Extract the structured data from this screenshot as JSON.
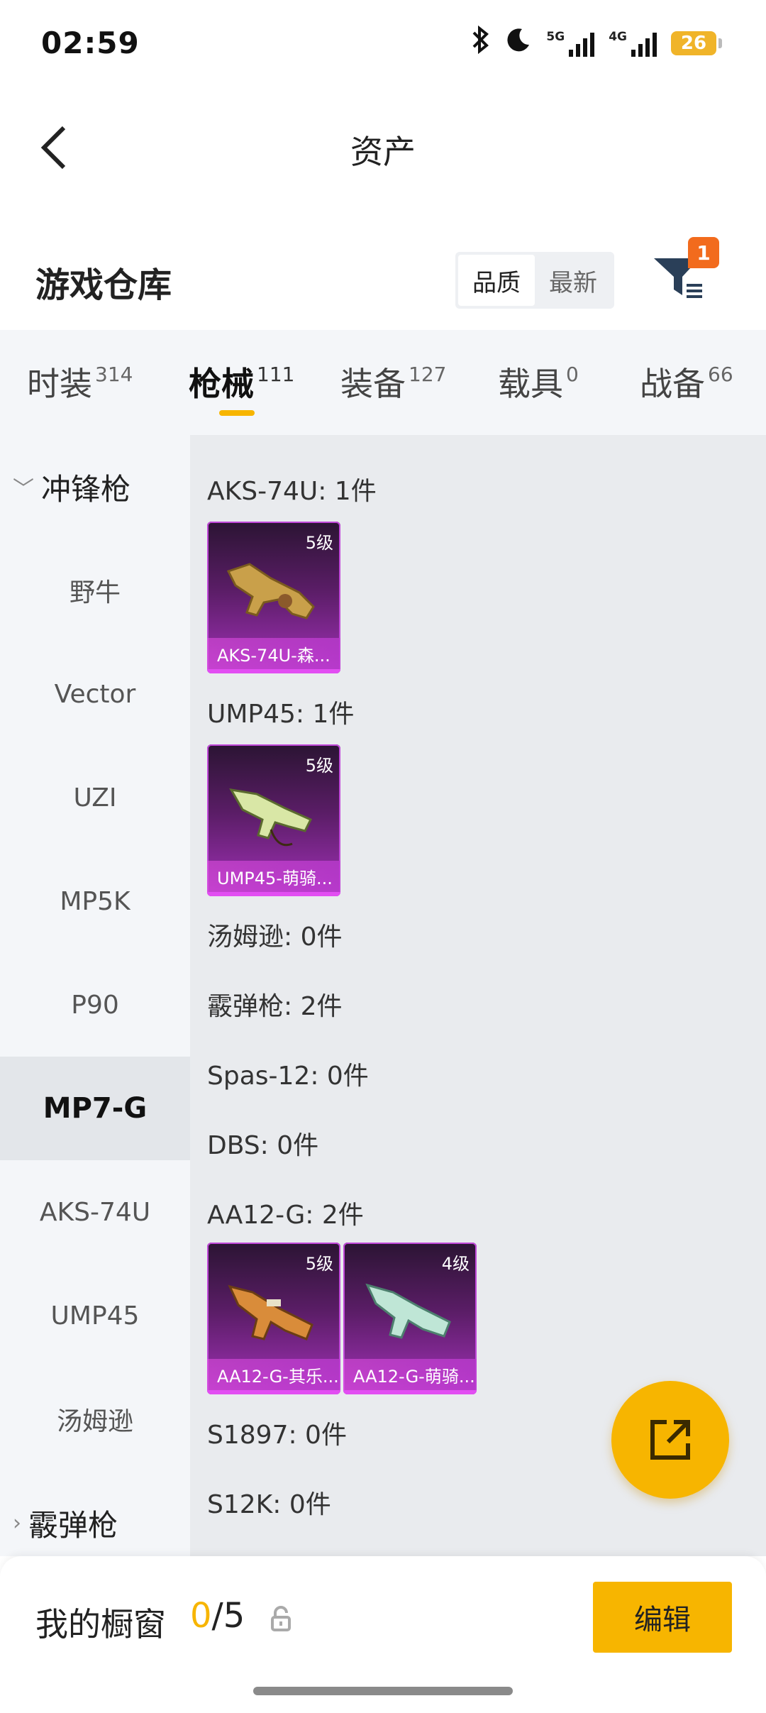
{
  "status_bar": {
    "time": "02:59",
    "battery": "26",
    "net1": "5G",
    "net2": "4G"
  },
  "header": {
    "title": "资产"
  },
  "warehouse": {
    "title": "游戏仓库",
    "sort_options": [
      {
        "label": "品质",
        "active": true
      },
      {
        "label": "最新",
        "active": false
      }
    ],
    "filter_badge": "1"
  },
  "tabs": [
    {
      "label": "时装",
      "count": "314",
      "active": false
    },
    {
      "label": "枪械",
      "count": "111",
      "active": true
    },
    {
      "label": "装备",
      "count": "127",
      "active": false
    },
    {
      "label": "载具",
      "count": "0",
      "active": false
    },
    {
      "label": "战备",
      "count": "66",
      "active": false
    }
  ],
  "sidebar": {
    "group_open": "冲锋枪",
    "items": [
      "野牛",
      "Vector",
      "UZI",
      "MP5K",
      "P90",
      "MP7-G",
      "AKS-74U",
      "UMP45",
      "汤姆逊"
    ],
    "active_item": "MP7-G",
    "group_closed": "霰弹枪"
  },
  "content": {
    "rows": [
      {
        "label": "AKS-74U: 1件"
      },
      {
        "label": "UMP45: 1件"
      },
      {
        "label": "汤姆逊: 0件"
      },
      {
        "label": "霰弹枪: 2件"
      },
      {
        "label": "Spas-12: 0件"
      },
      {
        "label": "DBS: 0件"
      },
      {
        "label": "AA12-G: 2件"
      },
      {
        "label": "S1897: 0件"
      },
      {
        "label": "S12K: 0件"
      }
    ],
    "cards": [
      {
        "level": "5级",
        "name": "AKS-74U-森..."
      },
      {
        "level": "5级",
        "name": "UMP45-萌骑..."
      },
      {
        "level": "5级",
        "name": "AA12-G-其乐..."
      },
      {
        "level": "4级",
        "name": "AA12-G-萌骑..."
      }
    ]
  },
  "bottom_bar": {
    "label": "我的橱窗",
    "current": "0",
    "total": "/5",
    "edit_label": "编辑"
  },
  "colors": {
    "accent": "#f7b500",
    "badge": "#f26b1d",
    "card_purple": "#a231b8"
  }
}
